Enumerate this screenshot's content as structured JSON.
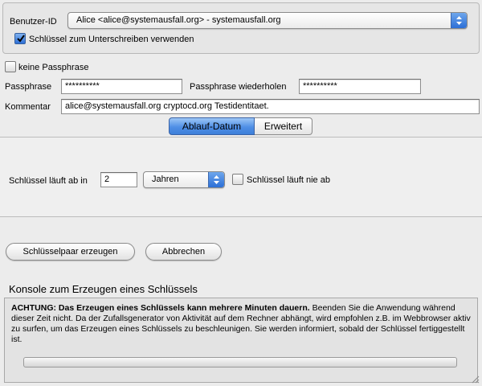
{
  "identity": {
    "user_id_label": "Benutzer-ID",
    "user_id_value": "Alice <alice@systemausfall.org> - systemausfall.org",
    "use_for_signing_label": "Schlüssel zum Unterschreiben verwenden",
    "use_for_signing_checked": true
  },
  "passphrase": {
    "no_passphrase_label": "keine Passphrase",
    "no_passphrase_checked": false,
    "passphrase_label": "Passphrase",
    "passphrase_value": "**********",
    "repeat_label": "Passphrase wiederholen",
    "repeat_value": "**********"
  },
  "comment": {
    "label": "Kommentar",
    "value": "alice@systemausfall.org cryptocd.org Testidentitaet."
  },
  "tabs": [
    {
      "label": "Ablauf-Datum",
      "active": true
    },
    {
      "label": "Erweitert",
      "active": false
    }
  ],
  "expiry": {
    "expires_in_label": "Schlüssel läuft ab in",
    "amount": "2",
    "unit": "Jahren",
    "never_expires_label": "Schlüssel läuft nie ab",
    "never_expires_checked": false
  },
  "actions": {
    "generate_label": "Schlüsselpaar erzeugen",
    "cancel_label": "Abbrechen"
  },
  "console": {
    "title": "Konsole zum Erzeugen eines Schlüssels",
    "warning_bold": "ACHTUNG: Das Erzeugen eines Schlüssels kann mehrere Minuten dauern.",
    "warning_rest": " Beenden Sie die Anwendung während dieser Zeit nicht. Da der Zufallsgenerator von Aktivität auf dem Rechner abhängt, wird empfohlen z.B. im Webbrowser aktiv zu surfen, um das Erzeugen eines Schlüssels zu beschleunigen. Sie werden informiert, sobald der Schlüssel fertiggestellt ist.",
    "progress": 0
  },
  "colors": {
    "accent_blue": "#3d7fd9",
    "window_bg": "#ececec"
  },
  "icons": {
    "popup_arrows": "updown-arrows-icon",
    "checkmark": "checkmark-icon",
    "resize_grip": "resize-grip-icon"
  }
}
